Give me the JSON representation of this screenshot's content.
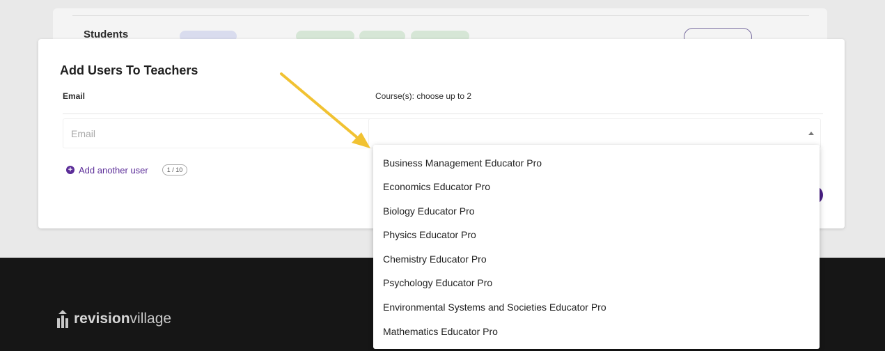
{
  "background": {
    "card_title": "Students"
  },
  "modal": {
    "title": "Add Users To Teachers",
    "email_label": "Email",
    "course_label": "Course(s): choose up to 2",
    "email_placeholder": "Email",
    "email_value": "",
    "add_user_label": "Add another user",
    "user_counter": "1 / 10"
  },
  "dropdown": {
    "options": [
      "Business Management Educator Pro",
      "Economics Educator Pro",
      "Biology Educator Pro",
      "Physics Educator Pro",
      "Chemistry Educator Pro",
      "Psychology Educator Pro",
      "Environmental Systems and Societies Educator Pro",
      "Mathematics Educator Pro"
    ]
  },
  "footer": {
    "logo_bold": "revision",
    "logo_light": "village"
  },
  "icons": {
    "dropdown_caret": "caret-up-icon",
    "add_user": "plus-circle-icon",
    "annotation": "arrow-icon"
  },
  "colors": {
    "accent_purple": "#5b2d98",
    "annotation_arrow": "#f1c232",
    "footer_bg": "#161616"
  }
}
